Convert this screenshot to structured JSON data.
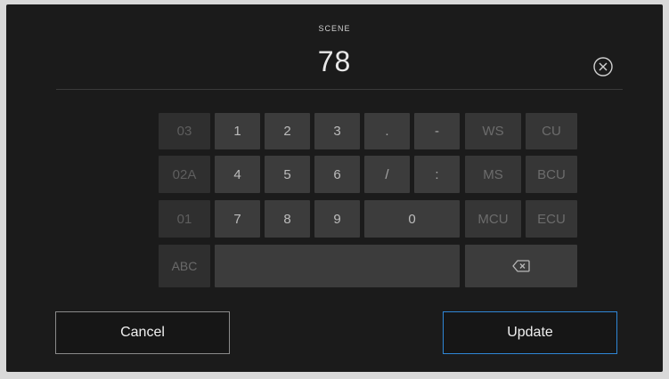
{
  "header": {
    "title": "SCENE",
    "value": "78"
  },
  "keypad": {
    "recent": [
      "03",
      "02A",
      "01"
    ],
    "digits": [
      "1",
      "2",
      "3",
      "4",
      "5",
      "6",
      "7",
      "8",
      "9",
      "0"
    ],
    "symbols": [
      ".",
      "-",
      "/",
      ":"
    ],
    "shots": [
      "WS",
      "CU",
      "MS",
      "BCU",
      "MCU",
      "ECU"
    ],
    "abc_label": "ABC",
    "space_label": ""
  },
  "actions": {
    "cancel_label": "Cancel",
    "update_label": "Update"
  },
  "colors": {
    "background": "#1b1b1b",
    "key": "#3c3c3c",
    "accent": "#2f86d6"
  },
  "icons": {
    "clear": "circle-x-icon",
    "backspace": "backspace-icon"
  }
}
